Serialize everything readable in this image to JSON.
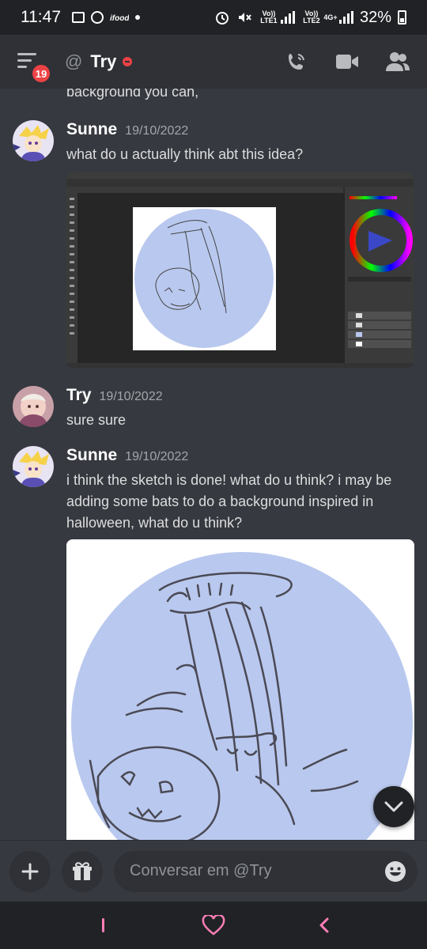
{
  "status_bar": {
    "time": "11:47",
    "sim1_label": "Vo)) LTE1",
    "sim2_label": "Vo)) LTE2",
    "network": "4G+",
    "battery": "32%"
  },
  "header": {
    "badge_count": "19",
    "at_symbol": "@",
    "channel_name": "Try",
    "status": "dnd"
  },
  "messages": {
    "prev_fragment": "background you can,",
    "items": [
      {
        "author": "Sunne",
        "timestamp": "19/10/2022",
        "text": "what do u actually think abt this idea?",
        "attachment": "photoshop-screenshot"
      },
      {
        "author": "Try",
        "timestamp": "19/10/2022",
        "text": "sure sure"
      },
      {
        "author": "Sunne",
        "timestamp": "19/10/2022",
        "text": "i think the sketch is done! what do u think? i may be adding some bats to do a background inspired in halloween, what do u think?",
        "attachment": "sketch-image"
      }
    ]
  },
  "input": {
    "placeholder": "Conversar em @Try"
  },
  "colors": {
    "background": "#36393f",
    "header": "#2f3136",
    "accent_red": "#ed4245",
    "sketch_blue": "#b9c8ee",
    "heart_pink": "#ff7eb6"
  }
}
